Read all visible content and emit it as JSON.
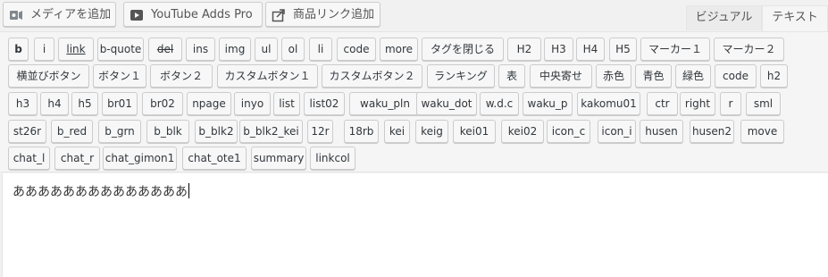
{
  "media_buttons": [
    {
      "name": "add-media-button",
      "label": "メディアを追加",
      "icon": "media-icon"
    },
    {
      "name": "youtube-adds-pro-button",
      "label": "YouTube Adds Pro",
      "icon": "youtube-play-icon"
    },
    {
      "name": "add-product-link-button",
      "label": "商品リンク追加",
      "icon": "share-link-icon"
    }
  ],
  "tabs": {
    "visual": "ビジュアル",
    "text": "テキスト",
    "active": "text"
  },
  "quicktags": [
    "b",
    "i",
    "link",
    "b-quote",
    "del",
    "ins",
    "img",
    "ul",
    "ol",
    "li",
    "code",
    "more",
    "タグを閉じる",
    "H2",
    "H3",
    "H4",
    "H5",
    "マーカー１",
    "マーカー２",
    "横並びボタン",
    "ボタン１",
    "ボタン２",
    "カスタムボタン１",
    "カスタムボタン２",
    "ランキング",
    "表",
    "中央寄せ",
    "赤色",
    "青色",
    "緑色",
    "code",
    "h2",
    "h3",
    "h4",
    "h5",
    "br01",
    "br02",
    "npage",
    "inyo",
    "list",
    "list02",
    "waku_pln",
    "waku_dot",
    "w.d.c",
    "waku_p",
    "kakomu01",
    "ctr",
    "right",
    "r",
    "sml",
    "st26r",
    "b_red",
    "b_grn",
    "b_blk",
    "b_blk2",
    "b_blk2_kei",
    "12r",
    "18rb",
    "kei",
    "keig",
    "kei01",
    "kei02",
    "icon_c",
    "icon_i",
    "husen",
    "husen2",
    "move",
    "chat_l",
    "chat_r",
    "chat_gimon1",
    "chat_ote1",
    "summary",
    "linkcol"
  ],
  "editor": {
    "content": "ああああああああああああああ"
  },
  "colors": {
    "toolbar_bg": "#f5f5f5",
    "button_border": "#cccccc",
    "editor_bg": "#ffffff"
  }
}
